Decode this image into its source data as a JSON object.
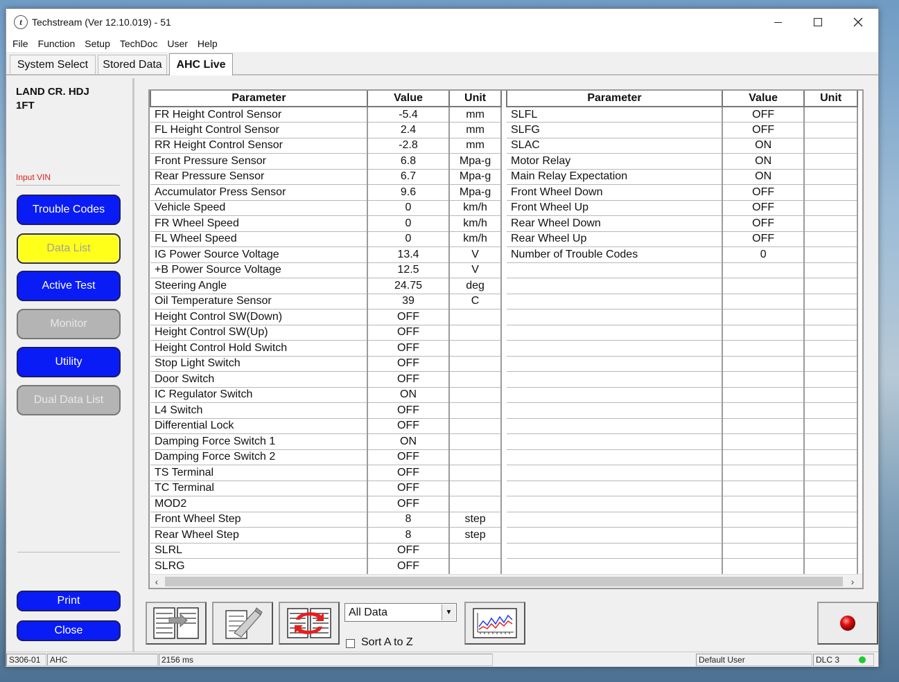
{
  "window": {
    "title": "Techstream (Ver 12.10.019) - 51",
    "app_icon_glyph": "t"
  },
  "menu": [
    "File",
    "Function",
    "Setup",
    "TechDoc",
    "User",
    "Help"
  ],
  "tabs": [
    {
      "label": "System Select",
      "active": false
    },
    {
      "label": "Stored Data",
      "active": false
    },
    {
      "label": "AHC Live",
      "active": true
    }
  ],
  "sidebar": {
    "vehicle": "LAND CR. HDJ\n1FT",
    "input_vin": "Input VIN",
    "buttons": {
      "trouble_codes": "Trouble Codes",
      "data_list": "Data List",
      "active_test": "Active Test",
      "monitor": "Monitor",
      "utility": "Utility",
      "dual_data_list": "Dual Data List",
      "print": "Print",
      "close": "Close"
    },
    "colors": {
      "active_blue": "#0a1cf5",
      "selected_yellow": "#ffff1a",
      "disabled_grey": "#b4b4b4"
    }
  },
  "table": {
    "headers": {
      "parameter": "Parameter",
      "value": "Value",
      "unit": "Unit"
    },
    "left_rows": [
      {
        "parameter": "FR Height Control Sensor",
        "value": "-5.4",
        "unit": "mm"
      },
      {
        "parameter": "FL Height Control Sensor",
        "value": "2.4",
        "unit": "mm"
      },
      {
        "parameter": "RR Height Control Sensor",
        "value": "-2.8",
        "unit": "mm"
      },
      {
        "parameter": "Front Pressure Sensor",
        "value": "6.8",
        "unit": "Mpa-g"
      },
      {
        "parameter": "Rear Pressure Sensor",
        "value": "6.7",
        "unit": "Mpa-g"
      },
      {
        "parameter": "Accumulator Press Sensor",
        "value": "9.6",
        "unit": "Mpa-g"
      },
      {
        "parameter": "Vehicle Speed",
        "value": "0",
        "unit": "km/h"
      },
      {
        "parameter": "FR Wheel Speed",
        "value": "0",
        "unit": "km/h"
      },
      {
        "parameter": "FL Wheel Speed",
        "value": "0",
        "unit": "km/h"
      },
      {
        "parameter": "IG Power Source Voltage",
        "value": "13.4",
        "unit": "V"
      },
      {
        "parameter": "+B Power Source Voltage",
        "value": "12.5",
        "unit": "V"
      },
      {
        "parameter": "Steering Angle",
        "value": "24.75",
        "unit": "deg"
      },
      {
        "parameter": "Oil Temperature Sensor",
        "value": "39",
        "unit": "C"
      },
      {
        "parameter": "Height Control SW(Down)",
        "value": "OFF",
        "unit": ""
      },
      {
        "parameter": "Height Control SW(Up)",
        "value": "OFF",
        "unit": ""
      },
      {
        "parameter": "Height Control Hold Switch",
        "value": "OFF",
        "unit": ""
      },
      {
        "parameter": "Stop Light Switch",
        "value": "OFF",
        "unit": ""
      },
      {
        "parameter": "Door Switch",
        "value": "OFF",
        "unit": ""
      },
      {
        "parameter": "IC Regulator Switch",
        "value": "ON",
        "unit": ""
      },
      {
        "parameter": "L4 Switch",
        "value": "OFF",
        "unit": ""
      },
      {
        "parameter": "Differential Lock",
        "value": "OFF",
        "unit": ""
      },
      {
        "parameter": "Damping Force Switch 1",
        "value": "ON",
        "unit": ""
      },
      {
        "parameter": "Damping Force Switch 2",
        "value": "OFF",
        "unit": ""
      },
      {
        "parameter": "TS Terminal",
        "value": "OFF",
        "unit": ""
      },
      {
        "parameter": "TC Terminal",
        "value": "OFF",
        "unit": ""
      },
      {
        "parameter": "MOD2",
        "value": "OFF",
        "unit": ""
      },
      {
        "parameter": "Front Wheel Step",
        "value": "8",
        "unit": "step"
      },
      {
        "parameter": "Rear Wheel Step",
        "value": "8",
        "unit": "step"
      },
      {
        "parameter": "SLRL",
        "value": "OFF",
        "unit": ""
      },
      {
        "parameter": "SLRG",
        "value": "OFF",
        "unit": ""
      }
    ],
    "right_rows": [
      {
        "parameter": "SLFL",
        "value": "OFF",
        "unit": ""
      },
      {
        "parameter": "SLFG",
        "value": "OFF",
        "unit": ""
      },
      {
        "parameter": "SLAC",
        "value": "ON",
        "unit": ""
      },
      {
        "parameter": "Motor Relay",
        "value": "ON",
        "unit": ""
      },
      {
        "parameter": "Main Relay Expectation",
        "value": "ON",
        "unit": ""
      },
      {
        "parameter": "Front Wheel Down",
        "value": "OFF",
        "unit": ""
      },
      {
        "parameter": "Front Wheel Up",
        "value": "OFF",
        "unit": ""
      },
      {
        "parameter": "Rear Wheel Down",
        "value": "OFF",
        "unit": ""
      },
      {
        "parameter": "Rear Wheel Up",
        "value": "OFF",
        "unit": ""
      },
      {
        "parameter": "Number of Trouble Codes",
        "value": "0",
        "unit": ""
      },
      {
        "parameter": "",
        "value": "",
        "unit": ""
      },
      {
        "parameter": "",
        "value": "",
        "unit": ""
      },
      {
        "parameter": "",
        "value": "",
        "unit": ""
      },
      {
        "parameter": "",
        "value": "",
        "unit": ""
      },
      {
        "parameter": "",
        "value": "",
        "unit": ""
      },
      {
        "parameter": "",
        "value": "",
        "unit": ""
      },
      {
        "parameter": "",
        "value": "",
        "unit": ""
      },
      {
        "parameter": "",
        "value": "",
        "unit": ""
      },
      {
        "parameter": "",
        "value": "",
        "unit": ""
      },
      {
        "parameter": "",
        "value": "",
        "unit": ""
      },
      {
        "parameter": "",
        "value": "",
        "unit": ""
      },
      {
        "parameter": "",
        "value": "",
        "unit": ""
      },
      {
        "parameter": "",
        "value": "",
        "unit": ""
      },
      {
        "parameter": "",
        "value": "",
        "unit": ""
      },
      {
        "parameter": "",
        "value": "",
        "unit": ""
      },
      {
        "parameter": "",
        "value": "",
        "unit": ""
      },
      {
        "parameter": "",
        "value": "",
        "unit": ""
      },
      {
        "parameter": "",
        "value": "",
        "unit": ""
      },
      {
        "parameter": "",
        "value": "",
        "unit": ""
      },
      {
        "parameter": "",
        "value": "",
        "unit": ""
      }
    ]
  },
  "toolbar": {
    "filter_selected": "All Data",
    "sort_label": "Sort A to Z",
    "sort_checked": false,
    "icons": [
      "select-parameters-icon",
      "snapshot-record-icon",
      "refresh-swap-icon",
      "graph-icon",
      "record-red-icon"
    ]
  },
  "statusbar": {
    "code": "S306-01",
    "system": "AHC",
    "timing": "2156 ms",
    "user": "Default User",
    "connection": "DLC 3",
    "connection_color": "#1fcc2e"
  }
}
